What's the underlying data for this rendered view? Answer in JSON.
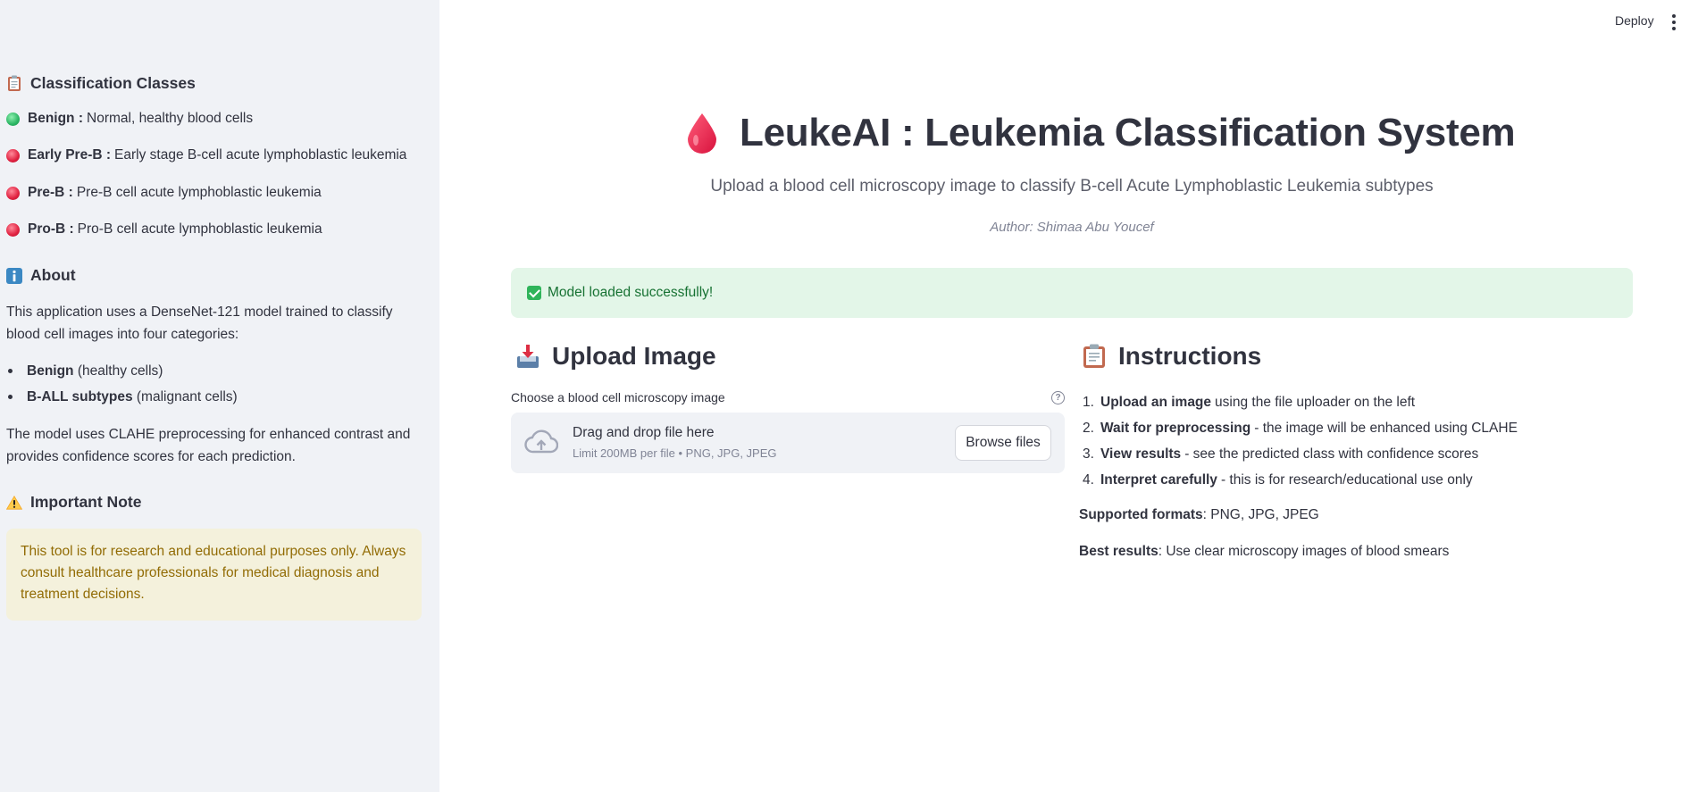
{
  "header": {
    "deploy_label": "Deploy"
  },
  "sidebar": {
    "classes_heading": "Classification Classes",
    "classes": [
      {
        "name": "Benign :",
        "desc": "Normal, healthy blood cells",
        "color": "#2ab563"
      },
      {
        "name": "Early Pre-B :",
        "desc": "Early stage B-cell acute lymphoblastic leukemia",
        "color": "#e0203f"
      },
      {
        "name": "Pre-B :",
        "desc": "Pre-B cell acute lymphoblastic leukemia",
        "color": "#e0203f"
      },
      {
        "name": "Pro-B :",
        "desc": "Pro-B cell acute lymphoblastic leukemia",
        "color": "#e0203f"
      }
    ],
    "about_heading": "About",
    "about_text": "This application uses a DenseNet-121 model trained to classify blood cell images into four categories:",
    "about_list": [
      {
        "bold": "Benign",
        "rest": " (healthy cells)"
      },
      {
        "bold": "B-ALL subtypes",
        "rest": " (malignant cells)"
      }
    ],
    "about_text2": "The model uses CLAHE preprocessing for enhanced contrast and provides confidence scores for each prediction.",
    "note_heading": "Important Note",
    "note_text": "This tool is for research and educational purposes only. Always consult healthcare professionals for medical diagnosis and treatment decisions."
  },
  "main": {
    "title": "LeukeAI : Leukemia Classification System",
    "subtitle": "Upload a blood cell microscopy image to classify B-cell Acute Lymphoblastic Leukemia subtypes",
    "author": "Author: Shimaa Abu Youcef",
    "success_message": "Model loaded successfully!",
    "upload": {
      "heading": "Upload Image",
      "label": "Choose a blood cell microscopy image",
      "help_symbol": "?",
      "drop_text": "Drag and drop file here",
      "limit_text": "Limit 200MB per file • PNG, JPG, JPEG",
      "browse_label": "Browse files"
    },
    "instructions": {
      "heading": "Instructions",
      "steps": [
        {
          "num": "1.",
          "bold": "Upload an image",
          "rest": " using the file uploader on the left"
        },
        {
          "num": "2.",
          "bold": "Wait for preprocessing",
          "rest": " - the image will be enhanced using CLAHE"
        },
        {
          "num": "3.",
          "bold": "View results",
          "rest": " - see the predicted class with confidence scores"
        },
        {
          "num": "4.",
          "bold": "Interpret carefully",
          "rest": " - this is for research/educational use only"
        }
      ],
      "formats_label": "Supported formats",
      "formats_value": ": PNG, JPG, JPEG",
      "best_label": "Best results",
      "best_value": ": Use clear microscopy images of blood smears"
    }
  },
  "icons": {
    "clipboard": "clipboard-icon",
    "info": "info-icon",
    "warning": "warning-icon",
    "drop": "blood-drop-icon",
    "inbox": "inbox-tray-icon",
    "cloud": "cloud-upload-icon"
  },
  "colors": {
    "sidebar_bg": "#f0f2f6",
    "success_bg": "#e3f6e8",
    "success_text": "#177233",
    "warning_bg": "#f4f1dc",
    "warning_text": "#926c05",
    "drop_red": "#e8224a"
  }
}
